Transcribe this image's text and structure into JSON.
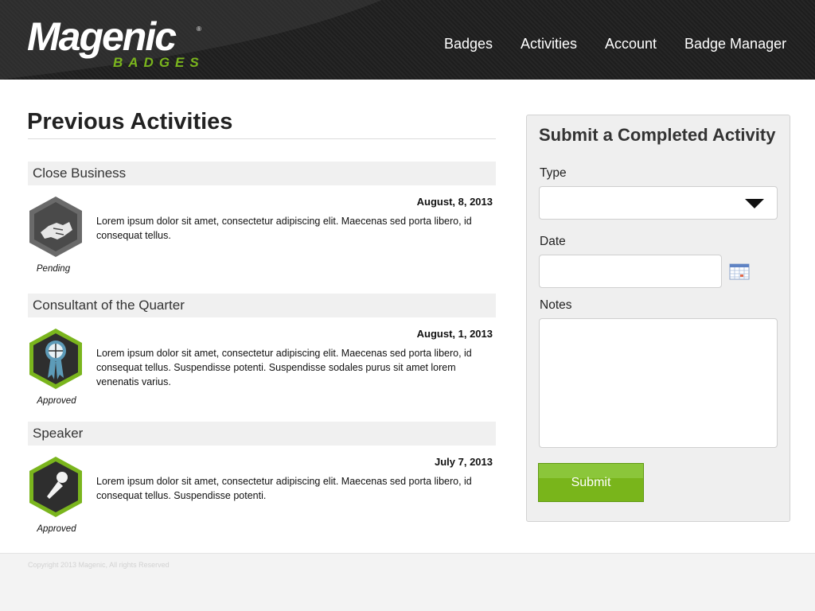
{
  "brand": {
    "name": "Magenic",
    "registered": "®",
    "sub": "BADGES"
  },
  "nav": {
    "items": [
      {
        "label": "Badges"
      },
      {
        "label": "Activities",
        "active": true
      },
      {
        "label": "Account"
      },
      {
        "label": "Badge Manager"
      }
    ]
  },
  "main": {
    "title": "Previous Activities",
    "activities": [
      {
        "title": "Close Business",
        "date": "August, 8, 2013",
        "description": "Lorem ipsum dolor sit amet, consectetur adipiscing elit. Maecenas sed porta libero, id consequat tellus.",
        "status": "Pending",
        "icon": "handshake-icon"
      },
      {
        "title": "Consultant of the Quarter",
        "date": "August, 1, 2013",
        "description": "Lorem ipsum dolor sit amet, consectetur adipiscing elit. Maecenas sed porta libero, id consequat tellus. Suspendisse potenti. Suspendisse sodales purus sit amet lorem venenatis varius.",
        "status": "Approved",
        "icon": "award-ribbon-icon"
      },
      {
        "title": "Speaker",
        "date": "July 7, 2013",
        "description": "Lorem ipsum dolor sit amet, consectetur adipiscing elit. Maecenas sed porta libero, id consequat tellus. Suspendisse potenti.",
        "status": "Approved",
        "icon": "microphone-icon"
      }
    ]
  },
  "form": {
    "title": "Submit a Completed Activity",
    "type_label": "Type",
    "type_value": "",
    "date_label": "Date",
    "date_value": "",
    "notes_label": "Notes",
    "notes_value": "",
    "submit_label": "Submit"
  },
  "footer": {
    "copyright": "Copyright 2013 Magenic, All rights Reserved"
  },
  "colors": {
    "accent_green": "#7ab51d",
    "header_dark": "#222222",
    "pending_gray": "#5a5a5a"
  }
}
